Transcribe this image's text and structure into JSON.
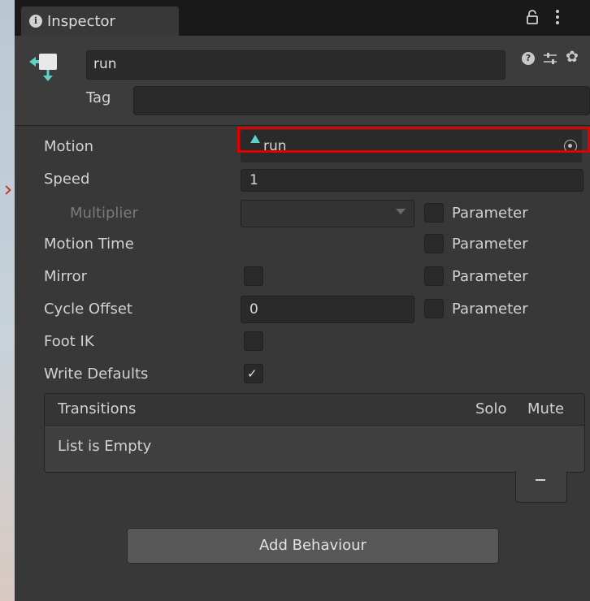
{
  "window": {
    "tab_title": "Inspector",
    "tab_icon": "info-icon",
    "tab_icon_glyph": "i",
    "tab_actions": [
      "lock-icon",
      "kebab-menu-icon"
    ]
  },
  "header": {
    "state_icon": "animator-state-icon",
    "name_value": "run",
    "tag_label": "Tag",
    "tag_value": "",
    "help_glyph": "?",
    "gear_glyph": "✿",
    "actions": [
      "help-icon",
      "presets-icon",
      "settings-gear-icon"
    ]
  },
  "properties": {
    "motion_label": "Motion",
    "motion_value": "run",
    "speed_label": "Speed",
    "speed_value": "1",
    "multiplier_label": "Multiplier",
    "multiplier_value": "",
    "motion_time_label": "Motion Time",
    "mirror_label": "Mirror",
    "mirror_checked": false,
    "cycle_offset_label": "Cycle Offset",
    "cycle_offset_value": "0",
    "foot_ik_label": "Foot IK",
    "foot_ik_checked": false,
    "write_defaults_label": "Write Defaults",
    "write_defaults_checked": true,
    "checkmark_glyph": "✓",
    "parameter_label": "Parameter"
  },
  "transitions": {
    "title": "Transitions",
    "solo_label": "Solo",
    "mute_label": "Mute",
    "empty_text": "List is Empty"
  },
  "actions": {
    "add_behaviour_label": "Add Behaviour"
  },
  "colors": {
    "panel_bg": "#383838",
    "field_bg": "#2a2a2a",
    "highlight": "#e10000",
    "motion_accent": "#5ed1c8"
  }
}
